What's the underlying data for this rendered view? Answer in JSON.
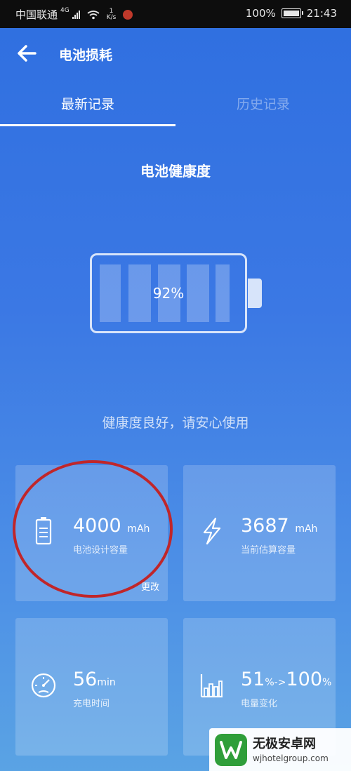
{
  "status_bar": {
    "carrier": "中国联通",
    "network_type": "4G",
    "net_speed_value": "1",
    "net_speed_unit": "K/s",
    "battery_percent": "100%",
    "time": "21:43"
  },
  "header": {
    "title": "电池损耗",
    "back_icon": "arrow-left-icon"
  },
  "tabs": [
    {
      "label": "最新记录",
      "active": true
    },
    {
      "label": "历史记录",
      "active": false
    }
  ],
  "health": {
    "section_title": "电池健康度",
    "percent_label": "92%",
    "percent_value": 92,
    "message": "健康度良好，请安心使用"
  },
  "cards": {
    "design_capacity": {
      "value": "4000",
      "unit": "mAh",
      "label": "电池设计容量",
      "action": "更改",
      "icon": "battery-outline-icon"
    },
    "estimated_capacity": {
      "value": "3687",
      "unit": "mAh",
      "label": "当前估算容量",
      "icon": "lightning-icon"
    },
    "charge_time": {
      "value": "56",
      "unit": "min",
      "label": "充电时间",
      "icon": "speedometer-icon"
    },
    "charge_change": {
      "from_value": "51",
      "from_unit": "%",
      "arrow": "->",
      "to_value": "100",
      "to_unit": "%",
      "label": "电量变化",
      "icon": "bar-chart-icon"
    }
  },
  "watermark": {
    "name": "无极安卓网",
    "url": "wjhotelgroup.com"
  },
  "colors": {
    "status_bar_bg": "#0d0d0d",
    "background_top": "#2f6fe0",
    "background_bottom": "#5aa3e4",
    "annotation_circle": "#c0262a"
  }
}
